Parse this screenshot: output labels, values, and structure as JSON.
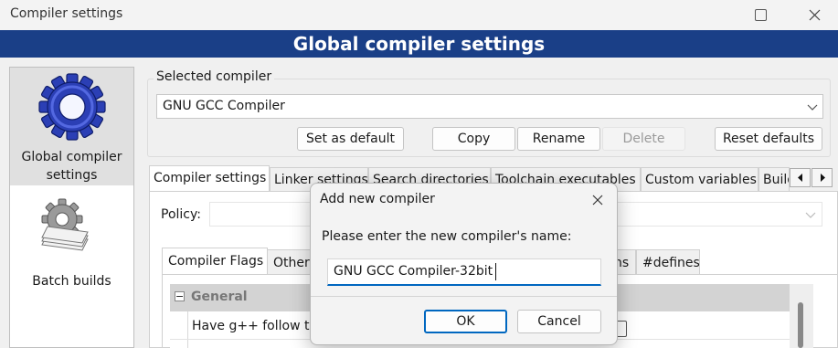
{
  "window": {
    "title": "Compiler settings"
  },
  "banner": {
    "title": "Global compiler settings"
  },
  "left_panel": {
    "items": [
      {
        "label": "Global compiler settings",
        "icon": "gear-icon",
        "selected": true
      },
      {
        "label": "Batch builds",
        "icon": "batch-builds-icon",
        "selected": false
      }
    ]
  },
  "compiler": {
    "group_label": "Selected compiler",
    "selected": "GNU GCC Compiler",
    "buttons": {
      "set_default": "Set as default",
      "copy": "Copy",
      "rename": "Rename",
      "delete": "Delete",
      "reset": "Reset defaults"
    }
  },
  "tabs": [
    "Compiler settings",
    "Linker settings",
    "Search directories",
    "Toolchain executables",
    "Custom variables",
    "Build"
  ],
  "policy_label": "Policy:",
  "subtabs": [
    "Compiler Flags",
    "Other",
    "ns",
    "#defines"
  ],
  "flags": {
    "group": "General",
    "row1": "Have g++ follow th"
  },
  "dialog": {
    "title": "Add new compiler",
    "prompt": "Please enter the new compiler's name:",
    "value": "GNU GCC Compiler-32bit",
    "ok": "OK",
    "cancel": "Cancel"
  },
  "colors": {
    "banner": "#1a3f87",
    "accent": "#0067c0"
  }
}
